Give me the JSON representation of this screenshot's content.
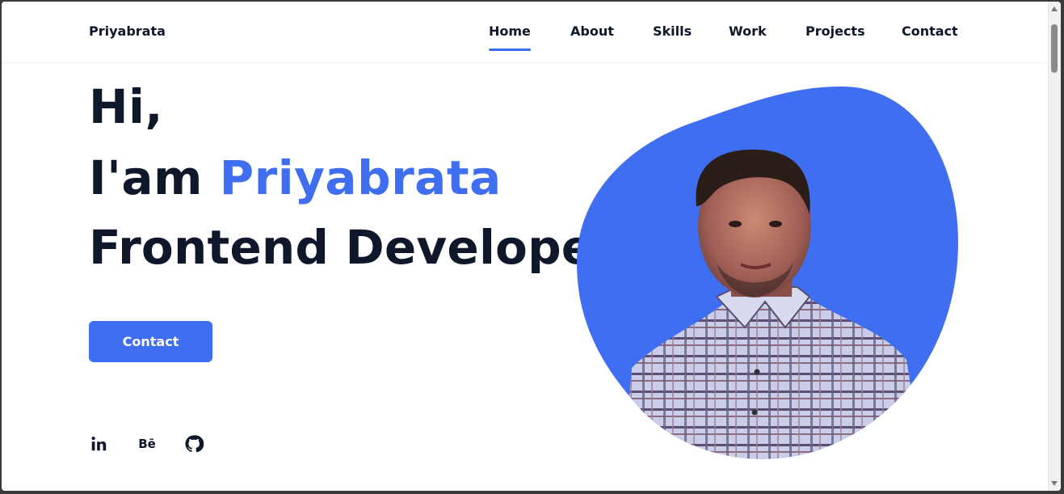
{
  "header": {
    "logo": "Priyabrata",
    "nav": [
      {
        "label": "Home",
        "active": true
      },
      {
        "label": "About",
        "active": false
      },
      {
        "label": "Skills",
        "active": false
      },
      {
        "label": "Work",
        "active": false
      },
      {
        "label": "Projects",
        "active": false
      },
      {
        "label": "Contact",
        "active": false
      }
    ]
  },
  "hero": {
    "greeting": "Hi,",
    "intro_prefix": "I'am",
    "name": "Priyabrata",
    "role": "Frontend Developer",
    "cta_label": "Contact"
  },
  "social": [
    {
      "icon": "linkedin-icon",
      "glyph": "in"
    },
    {
      "icon": "behance-icon",
      "glyph": "Bē"
    },
    {
      "icon": "github-icon",
      "glyph": ""
    }
  ],
  "colors": {
    "accent": "#3f6ff0",
    "text": "#0f172a",
    "background": "#ffffff"
  }
}
